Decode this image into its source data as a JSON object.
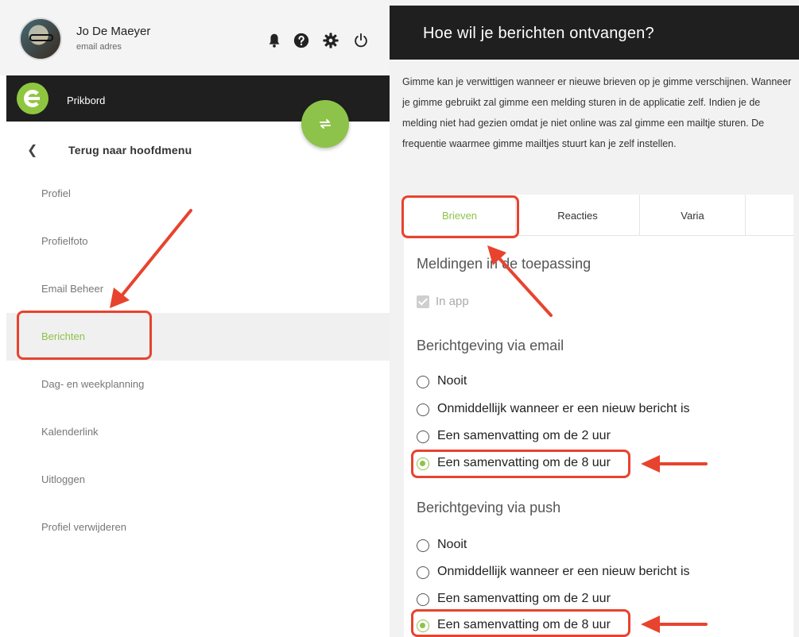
{
  "user": {
    "name": "Jo De Maeyer",
    "email": "email adres"
  },
  "topbar": {
    "icons": [
      "bell-icon",
      "help-icon",
      "gear-icon",
      "power-icon"
    ]
  },
  "brand": {
    "name": "Prikbord",
    "accent": "#8dc34a"
  },
  "fab": {
    "icon": "swap-icon"
  },
  "back": {
    "label": "Terug naar hoofdmenu"
  },
  "menu": {
    "items": [
      {
        "label": "Profiel"
      },
      {
        "label": "Profielfoto"
      },
      {
        "label": "Email Beheer"
      },
      {
        "label": "Berichten",
        "active": true
      },
      {
        "label": "Dag- en weekplanning"
      },
      {
        "label": "Kalenderlink"
      },
      {
        "label": "Uitloggen"
      },
      {
        "label": "Profiel verwijderen"
      }
    ]
  },
  "panel": {
    "title": "Hoe wil je berichten ontvangen?",
    "intro": "Gimme kan je verwittigen wanneer er nieuwe brieven op je gimme verschijnen. Wanneer je gimme gebruikt zal gimme een melding sturen in de applicatie zelf. Indien je de melding niet had gezien omdat je niet online was zal gimme een mailtje sturen. De frequentie waarmee gimme mailtjes stuurt kan je zelf instellen.",
    "tabs": [
      {
        "label": "Brieven",
        "active": true
      },
      {
        "label": "Reacties"
      },
      {
        "label": "Varia"
      }
    ],
    "app_section": {
      "title": "Meldingen in de toepassing",
      "checkbox_label": "In app",
      "checked": true
    },
    "email_section": {
      "title": "Berichtgeving via email",
      "options": [
        "Nooit",
        "Onmiddellijk wanneer er een nieuw bericht is",
        "Een samenvatting om de 2 uur",
        "Een samenvatting om de 8 uur"
      ],
      "selected": 3
    },
    "push_section": {
      "title": "Berichtgeving via push",
      "options": [
        "Nooit",
        "Onmiddellijk wanneer er een nieuw bericht is",
        "Een samenvatting om de 2 uur",
        "Een samenvatting om de 8 uur"
      ],
      "selected": 3
    }
  },
  "annotation_color": "#e8432e"
}
